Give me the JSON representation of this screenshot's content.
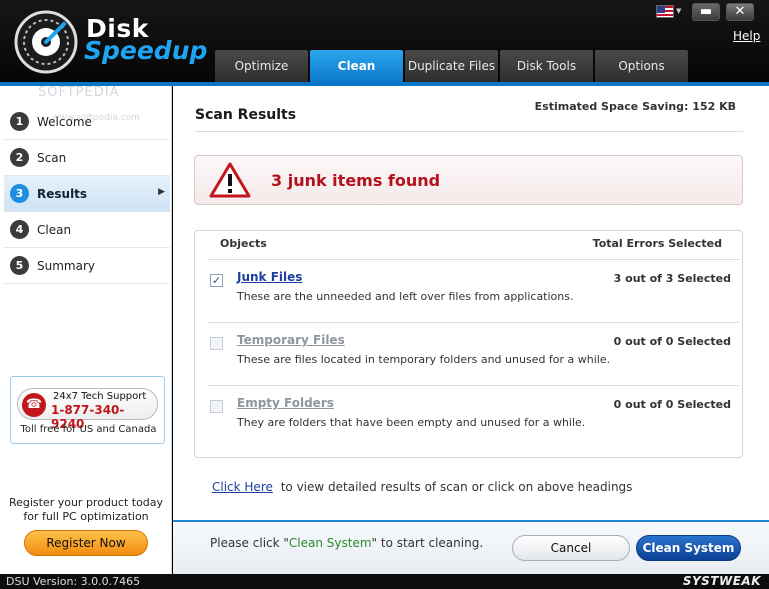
{
  "app": {
    "brand_line1": "Disk",
    "brand_line2": "Speedup",
    "help": "Help",
    "win_min": "▬",
    "win_close": "✕",
    "flag_arrow": "▼"
  },
  "tabs": [
    {
      "label": "Optimize"
    },
    {
      "label": "Clean"
    },
    {
      "label": "Duplicate Files"
    },
    {
      "label": "Disk Tools"
    },
    {
      "label": "Options"
    }
  ],
  "steps": [
    {
      "num": "1",
      "label": "Welcome"
    },
    {
      "num": "2",
      "label": "Scan"
    },
    {
      "num": "3",
      "label": "Results"
    },
    {
      "num": "4",
      "label": "Clean"
    },
    {
      "num": "5",
      "label": "Summary"
    }
  ],
  "support": {
    "line1": "24x7 Tech Support",
    "phone": "1-877-340-9240",
    "note": "Toll free for US and Canada"
  },
  "register": {
    "line1": "Register your product today",
    "line2": "for full PC optimization",
    "button": "Register Now"
  },
  "main": {
    "title": "Scan Results",
    "saving": "Estimated Space Saving: 152 KB",
    "alert": "3 junk items found",
    "col_objects": "Objects",
    "col_total": "Total Errors Selected",
    "rows": [
      {
        "name": "Junk Files",
        "desc": "These are the unneeded and left over files from applications.",
        "count": "3 out of 3 Selected",
        "checked": "✓"
      },
      {
        "name": "Temporary Files",
        "desc": "These are files located in temporary folders and unused for a while.",
        "count": "0 out of 0 Selected",
        "checked": ""
      },
      {
        "name": "Empty Folders",
        "desc": "They are folders that have been empty and unused for a while.",
        "count": "0 out of 0 Selected",
        "checked": ""
      }
    ],
    "link": "Click Here",
    "link_rest": "to view detailed results of scan or click on above headings"
  },
  "bottom": {
    "hint_pre": "Please click \"",
    "hint_action": "Clean System",
    "hint_post": "\" to start cleaning.",
    "cancel": "Cancel",
    "clean": "Clean System"
  },
  "status": {
    "version": "DSU Version: 3.0.0.7465",
    "vendor": "SYSTWEAK"
  },
  "watermark": {
    "big": "SOFTPEDIA",
    "small": "www.softpedia.com"
  },
  "colors": {
    "accent": "#0b75c8",
    "alert": "#b3121c",
    "link": "#1e3fa0",
    "hint_green": "#2b8a2b"
  }
}
